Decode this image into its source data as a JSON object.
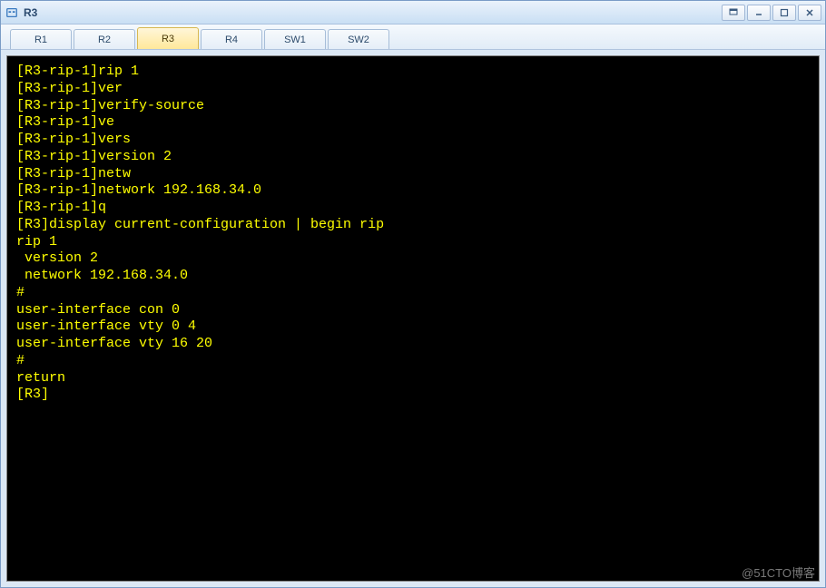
{
  "window": {
    "title": "R3"
  },
  "tabs": [
    {
      "label": "R1",
      "active": false
    },
    {
      "label": "R2",
      "active": false
    },
    {
      "label": "R3",
      "active": true
    },
    {
      "label": "R4",
      "active": false
    },
    {
      "label": "SW1",
      "active": false
    },
    {
      "label": "SW2",
      "active": false
    }
  ],
  "terminal": {
    "lines": [
      "[R3-rip-1]rip 1",
      "[R3-rip-1]ver",
      "[R3-rip-1]verify-source",
      "[R3-rip-1]ve",
      "[R3-rip-1]vers",
      "[R3-rip-1]version 2",
      "[R3-rip-1]netw",
      "[R3-rip-1]network 192.168.34.0",
      "[R3-rip-1]q",
      "[R3]display current-configuration | begin rip",
      "rip 1",
      " version 2",
      " network 192.168.34.0",
      "#",
      "user-interface con 0",
      "user-interface vty 0 4",
      "user-interface vty 16 20",
      "#",
      "return",
      "[R3]"
    ]
  },
  "watermark": "@51CTO博客"
}
